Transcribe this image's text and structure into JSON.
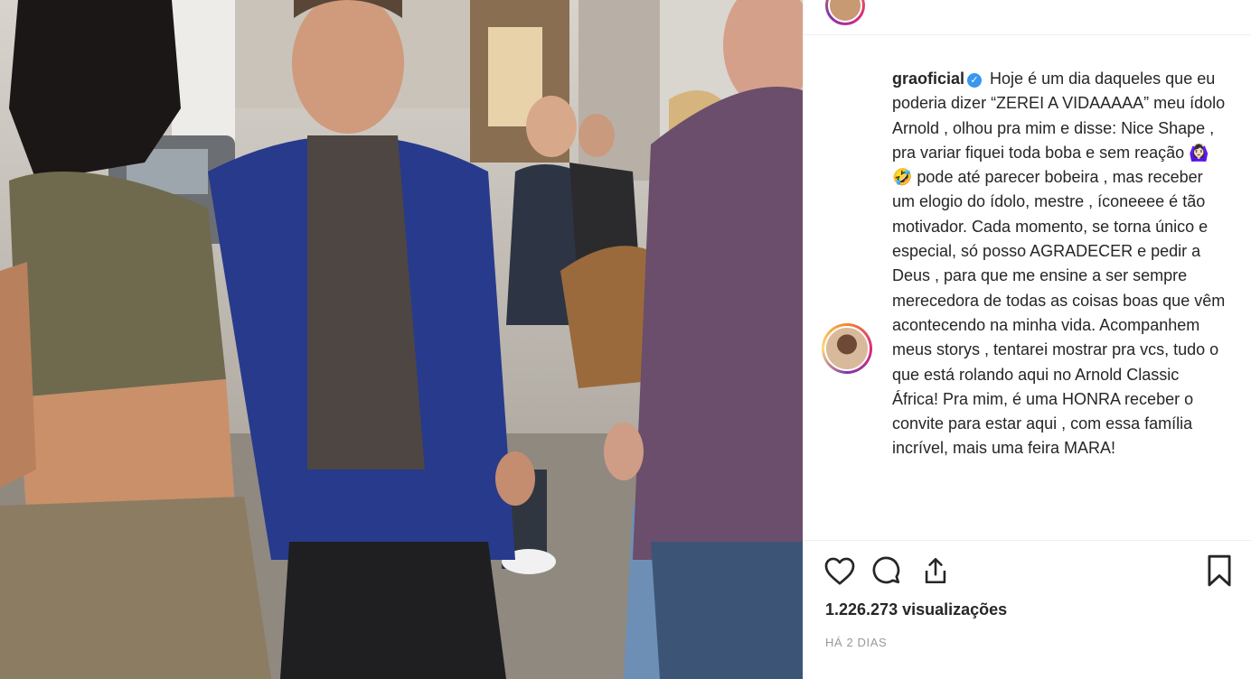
{
  "post": {
    "username": "graoficial",
    "caption": "Hoje é um dia daqueles que eu poderia dizer “ZEREI A VIDAAAAA” meu ídolo Arnold , olhou pra mim e disse: Nice Shape , pra variar fiquei toda boba e sem reação 🙆🏻‍♀️🤣 pode até parecer bobeira , mas receber um elogio do ídolo, mestre , íconeeee é tão motivador. Cada momento, se torna único e especial, só posso AGRADECER e pedir a Deus , para que me ensine a ser sempre merecedora de todas as coisas boas que vêm acontecendo na minha vida. Acompanhem meus storys , tentarei mostrar pra vcs, tudo o que está rolando aqui no Arnold Classic África! Pra mim, é uma HONRA receber o convite para estar aqui , com essa família incrível, mais uma feira MARA!",
    "views": "1.226.273 visualizações",
    "timestamp": "HÁ 2 DIAS"
  },
  "icons": {
    "like": "heart-icon",
    "comment": "comment-icon",
    "share": "share-icon",
    "save": "bookmark-icon",
    "verified": "verified-badge-icon"
  },
  "colors": {
    "text": "#262626",
    "muted": "#999999",
    "verified": "#3897f0",
    "divider": "#efefef"
  }
}
